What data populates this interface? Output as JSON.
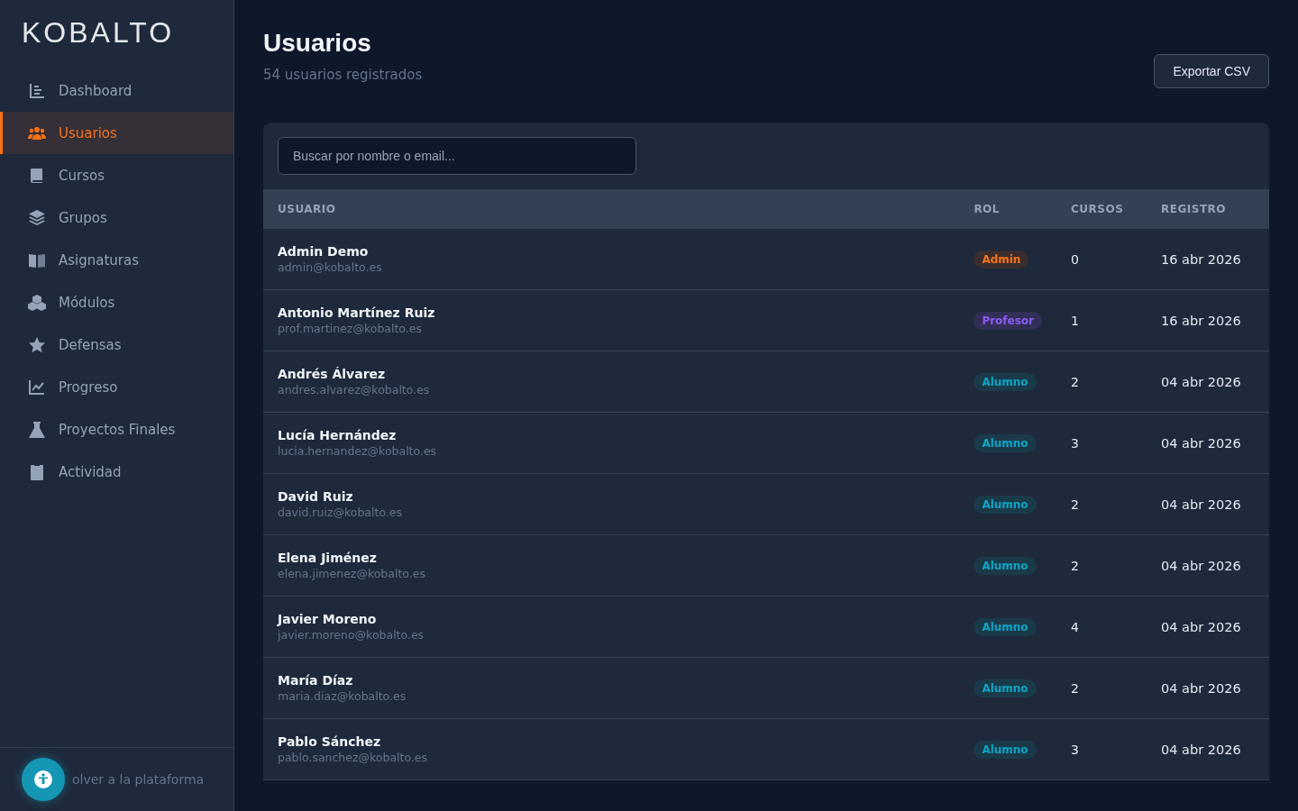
{
  "sidebar": {
    "logo": "KOBALTO",
    "items": [
      {
        "label": "Dashboard",
        "kind": "dashboard",
        "selected": false
      },
      {
        "label": "Usuarios",
        "kind": "users",
        "selected": true
      },
      {
        "label": "Cursos",
        "kind": "book",
        "selected": false
      },
      {
        "label": "Grupos",
        "kind": "layers",
        "selected": false
      },
      {
        "label": "Asignaturas",
        "kind": "openbook",
        "selected": false
      },
      {
        "label": "Módulos",
        "kind": "cubes",
        "selected": false
      },
      {
        "label": "Defensas",
        "kind": "star",
        "selected": false
      },
      {
        "label": "Progreso",
        "kind": "chart",
        "selected": false
      },
      {
        "label": "Proyectos Finales",
        "kind": "flask",
        "selected": false
      },
      {
        "label": "Actividad",
        "kind": "clipboard",
        "selected": false
      }
    ],
    "footer_link": "olver a la plataforma"
  },
  "header": {
    "title": "Usuarios",
    "subtitle": "54 usuarios registrados",
    "export_button": "Exportar CSV"
  },
  "search": {
    "placeholder": "Buscar por nombre o email..."
  },
  "table": {
    "columns": [
      "USUARIO",
      "ROL",
      "CURSOS",
      "REGISTRO"
    ],
    "rows": [
      {
        "name": "Admin Demo",
        "email": "admin@kobalto.es",
        "role": "Admin",
        "kind": "admin",
        "courses": "0",
        "date": "16 abr 2026"
      },
      {
        "name": "Antonio Martínez Ruiz",
        "email": "prof.martinez@kobalto.es",
        "role": "Profesor",
        "kind": "teacher",
        "courses": "1",
        "date": "16 abr 2026"
      },
      {
        "name": "Andrés Álvarez",
        "email": "andres.alvarez@kobalto.es",
        "role": "Alumno",
        "kind": "student",
        "courses": "2",
        "date": "04 abr 2026"
      },
      {
        "name": "Lucía Hernández",
        "email": "lucia.hernandez@kobalto.es",
        "role": "Alumno",
        "kind": "student",
        "courses": "3",
        "date": "04 abr 2026"
      },
      {
        "name": "David Ruiz",
        "email": "david.ruiz@kobalto.es",
        "role": "Alumno",
        "kind": "student",
        "courses": "2",
        "date": "04 abr 2026"
      },
      {
        "name": "Elena Jiménez",
        "email": "elena.jimenez@kobalto.es",
        "role": "Alumno",
        "kind": "student",
        "courses": "2",
        "date": "04 abr 2026"
      },
      {
        "name": "Javier Moreno",
        "email": "javier.moreno@kobalto.es",
        "role": "Alumno",
        "kind": "student",
        "courses": "4",
        "date": "04 abr 2026"
      },
      {
        "name": "María Díaz",
        "email": "maria.diaz@kobalto.es",
        "role": "Alumno",
        "kind": "student",
        "courses": "2",
        "date": "04 abr 2026"
      },
      {
        "name": "Pablo Sánchez",
        "email": "pablo.sanchez@kobalto.es",
        "role": "Alumno",
        "kind": "student",
        "courses": "3",
        "date": "04 abr 2026"
      }
    ]
  }
}
